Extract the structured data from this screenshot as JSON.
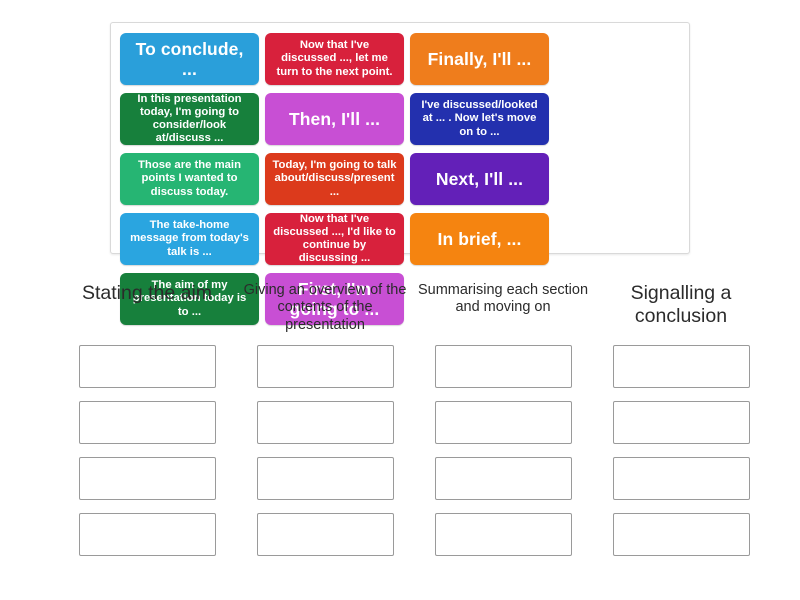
{
  "tiles": [
    {
      "text": "To conclude, ...",
      "color": "#2a9fda"
    },
    {
      "text": "Now that I've discussed ..., let me turn to the next point.",
      "color": "#d8213c"
    },
    {
      "text": "Finally, I'll ...",
      "color": "#ef7d1c"
    },
    {
      "text": "In this presentation today, I'm going to consider/look at/discuss ...",
      "color": "#17803c"
    },
    {
      "text": "Then, I'll ...",
      "color": "#c84fd4"
    },
    {
      "text": "I've discussed/looked at ... . Now let's move on to ...",
      "color": "#2330ae"
    },
    {
      "text": "Those are the main points I wanted to discuss today.",
      "color": "#26b573"
    },
    {
      "text": "Today, I'm going to talk about/discuss/present ...",
      "color": "#dc3a1c"
    },
    {
      "text": "Next, I'll ...",
      "color": "#6320b8"
    },
    {
      "text": "The take-home message from today's talk is ...",
      "color": "#2aa5e0"
    },
    {
      "text": "Now that I've discussed ..., I'd like to continue by discussing ...",
      "color": "#d8213c"
    },
    {
      "text": "In brief, ...",
      "color": "#f58410"
    },
    {
      "text": "The aim of my presentation today is to ...",
      "color": "#17803c"
    },
    {
      "text": "First, I'm going to ...",
      "color": "#c84fd4"
    }
  ],
  "columns": [
    {
      "title": "Stating the aim",
      "dropzone_count": 4
    },
    {
      "title": "Giving an overview of the contents of the presentation",
      "dropzone_count": 4
    },
    {
      "title": "Summarising each section and moving on",
      "dropzone_count": 4
    },
    {
      "title": "Signalling a conclusion",
      "dropzone_count": 4
    }
  ]
}
